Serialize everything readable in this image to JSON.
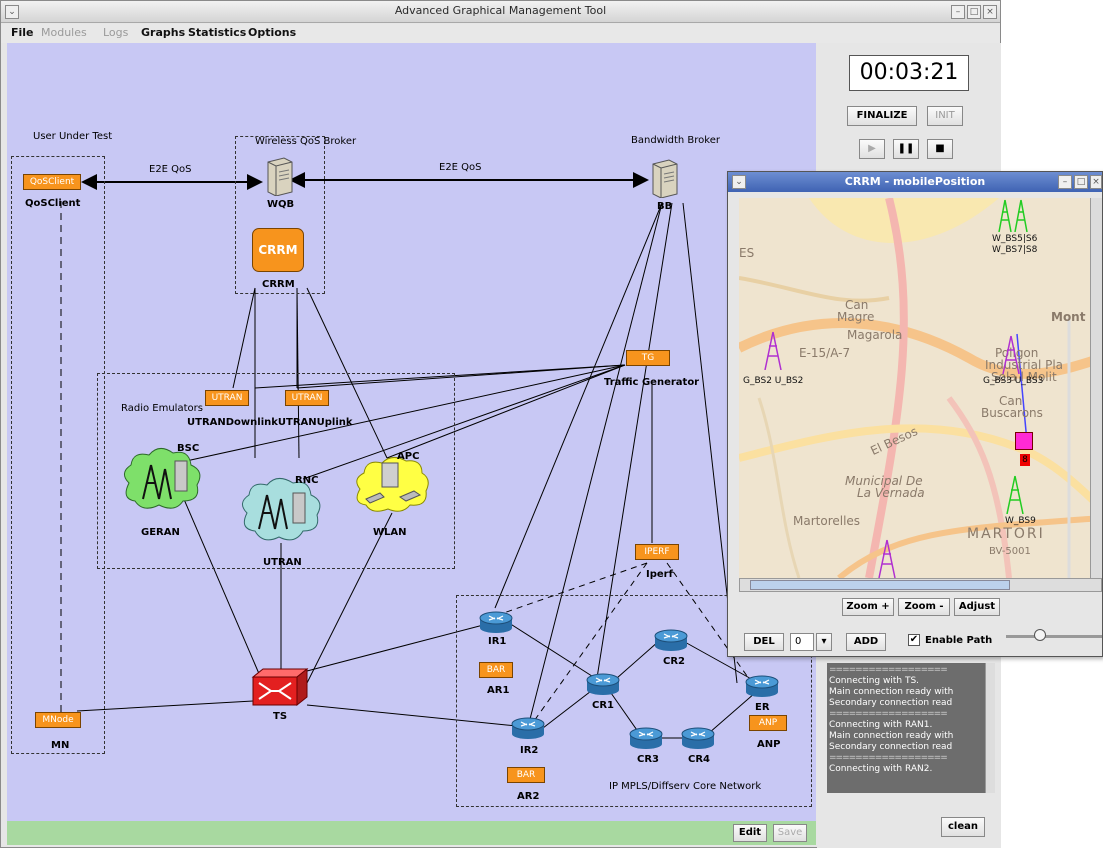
{
  "window": {
    "title": "Advanced Graphical Management Tool"
  },
  "menu": {
    "file": "File",
    "modules": "Modules",
    "logs": "Logs",
    "graphs": "Graphs",
    "statistics": "Statistics",
    "options": "Options"
  },
  "canvas": {
    "user_under_test": "User Under Test",
    "wireless_qos_broker": "Wireless QoS Broker",
    "bandwidth_broker": "Bandwidth Broker",
    "e2e_qos_left": "E2E QoS",
    "e2e_qos_right": "E2E QoS",
    "qosclient_box": "QoSClient",
    "qosclient_label": "QoSClient",
    "wqb_label": "WQB",
    "bb_label": "BB",
    "crrm_box": "CRRM",
    "crrm_label": "CRRM",
    "radio_emulators": "Radio Emulators",
    "utran_box_1": "UTRAN",
    "utran_box_2": "UTRAN",
    "utran_downlink_uplink": "UTRANDownlinkUTRANUplink",
    "tg_box": "TG",
    "traffic_generator": "Traffic Generator",
    "bsc": "BSC",
    "rnc": "RNC",
    "apc": "APC",
    "geran": "GERAN",
    "utran": "UTRAN",
    "wlan": "WLAN",
    "iperf_box": "IPERF",
    "iperf_label": "Iperf",
    "ts_label": "TS",
    "mnode_box": "MNode",
    "mn_label": "MN",
    "ir1": "IR1",
    "ir2": "IR2",
    "bar_box_1": "BAR",
    "bar_box_2": "BAR",
    "ar1": "AR1",
    "ar2": "AR2",
    "cr1": "CR1",
    "cr2": "CR2",
    "cr3": "CR3",
    "cr4": "CR4",
    "er": "ER",
    "anp_box": "ANP",
    "anp_label": "ANP",
    "core_network": "IP MPLS/Diffserv Core Network"
  },
  "statusbar": {
    "edit": "Edit",
    "save": "Save"
  },
  "control": {
    "timer": "00:03:21",
    "finalize": "FINALIZE",
    "init": "INIT",
    "clean": "clean",
    "log_lines": [
      "Connecting with TS.",
      "Main connection ready with",
      "Secondary connection read",
      "Connecting with RAN1.",
      "Main connection ready with",
      "Secondary connection read",
      "Connecting with RAN2."
    ]
  },
  "crrm_window": {
    "title": "CRRM - mobilePosition",
    "zoom_in": "Zoom +",
    "zoom_out": "Zoom -",
    "adjust": "Adjust",
    "del": "DEL",
    "select_value": "0",
    "add": "ADD",
    "enable_path": "Enable Path",
    "enable_path_checked": true,
    "map_labels": [
      "ES",
      "Can",
      "Magre",
      "Magarola",
      "E-15/A-7",
      "Mont",
      "Poligon",
      "Industrial Pla",
      "Sola l Molit",
      "Can",
      "Buscarons",
      "El Besos",
      "Municipal De",
      "La Vernada",
      "Martorelles",
      "MARTORI",
      "BV-5001"
    ],
    "stations": {
      "top_1": "W_BS5|S6",
      "top_2": "W_BS7|S8",
      "left": "G_BS2 U_BS2",
      "right": "G_BS3 U_BS3",
      "bottom": "W_BS9"
    },
    "mobile_badge": "8"
  }
}
